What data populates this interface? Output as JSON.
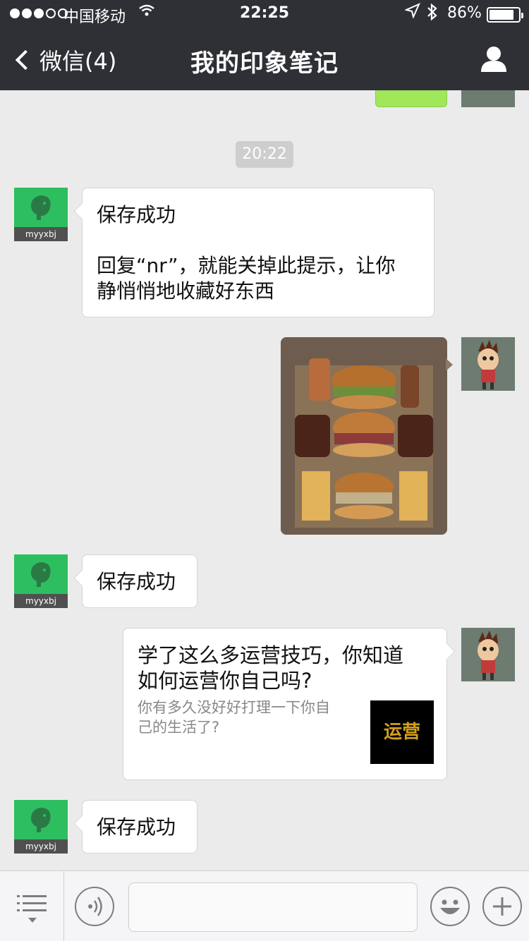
{
  "status_bar": {
    "carrier": "中国移动",
    "time": "22:25",
    "battery_percent": "86%",
    "battery_level": 0.86,
    "signal_bars_filled": 3,
    "signal_bars_total": 5
  },
  "nav": {
    "back_label": "微信(4)",
    "title": "我的印象笔记"
  },
  "chat": {
    "timestamp": "20:22",
    "bot_tag": "myyxbj",
    "messages": [
      {
        "sender": "bot",
        "line1": "保存成功",
        "line2": "回复“nr”，就能关掉此提示，让你",
        "line3": "静悄悄地收藏好东西"
      },
      {
        "sender": "user",
        "type": "image",
        "description_icon": "food-photo"
      },
      {
        "sender": "bot",
        "text": "保存成功"
      },
      {
        "sender": "user",
        "type": "link",
        "title_line1": "学了这么多运营技巧，你知道",
        "title_line2": "如何运营你自己吗?",
        "desc_line1": "你有多久没好好打理一下你自",
        "desc_line2": "己的生活了?",
        "thumb_text": "运营"
      },
      {
        "sender": "bot",
        "text": "保存成功"
      }
    ]
  },
  "colors": {
    "nav_bg": "#2f3035",
    "chat_bg": "#ebebeb",
    "bot_avatar": "#2dbe60",
    "sent_bubble": "#a0e75a"
  },
  "icons": {
    "back": "chevron-left-icon",
    "profile": "person-icon",
    "menu": "list-menu-icon",
    "voice": "voice-icon",
    "emoji": "emoji-icon",
    "plus": "plus-icon"
  }
}
